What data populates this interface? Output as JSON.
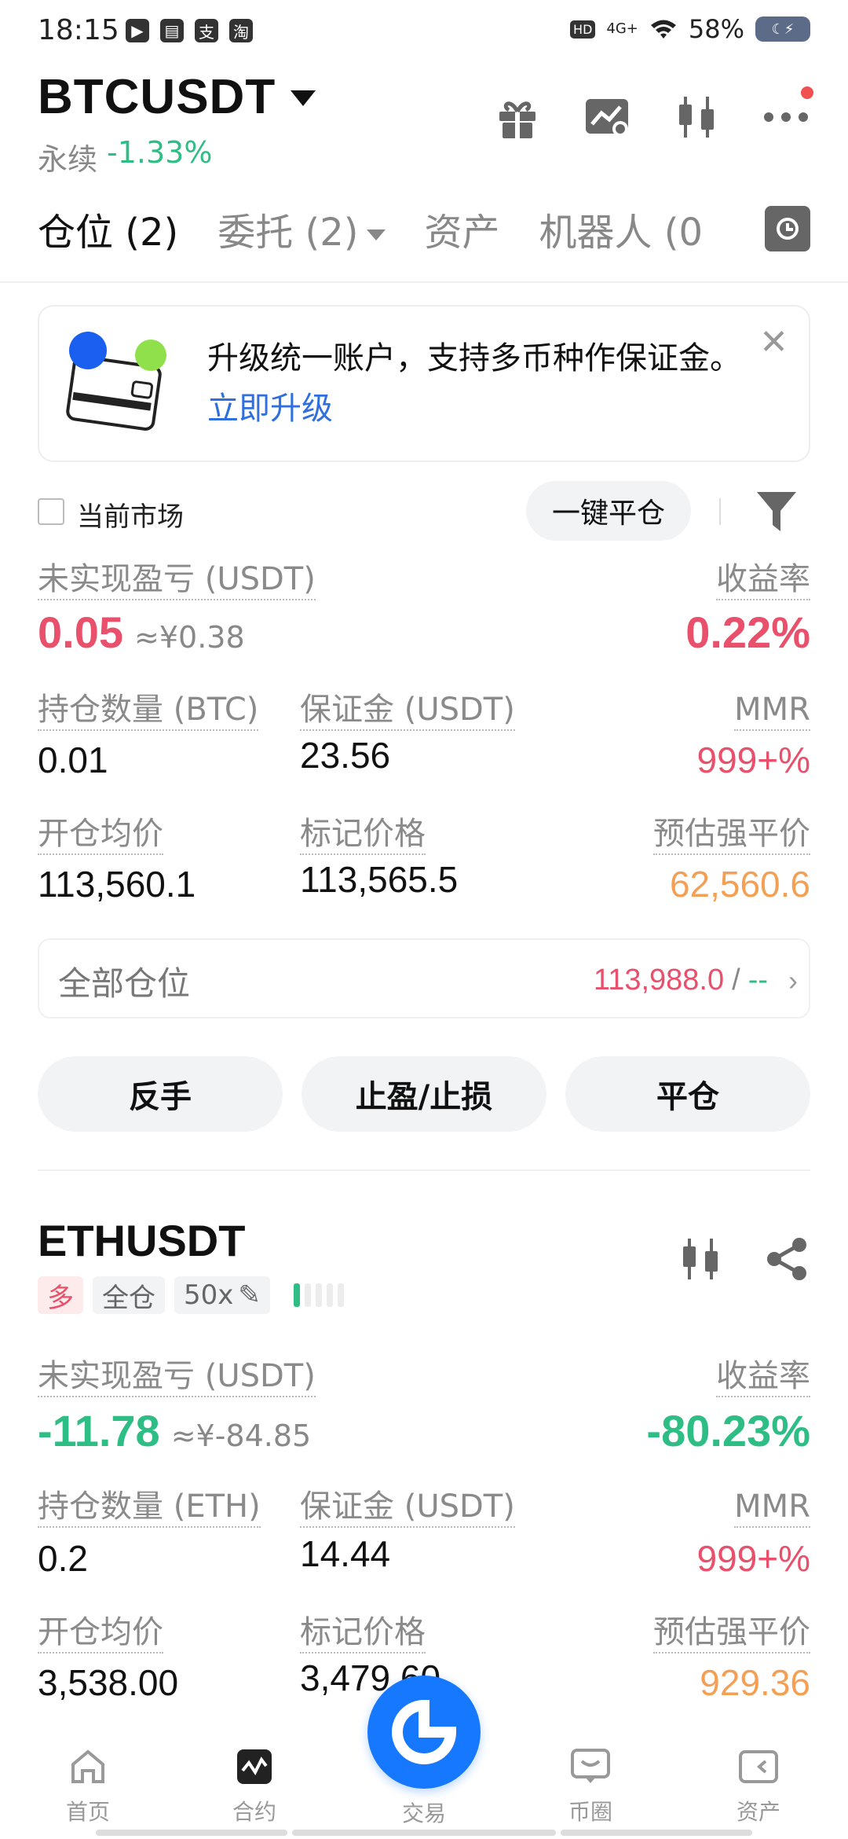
{
  "status_bar": {
    "time": "18:15",
    "icons": [
      "play-icon",
      "book-icon",
      "alipay-icon",
      "taobao-icon"
    ],
    "network": "4G+",
    "battery": "58%",
    "hd": "HD"
  },
  "header": {
    "pair": "BTCUSDT",
    "type": "永续",
    "change": "-1.33%"
  },
  "tabs": [
    {
      "label": "仓位 (2)",
      "active": true
    },
    {
      "label": "委托 (2)",
      "active": false
    },
    {
      "label": "资产",
      "active": false
    },
    {
      "label": "机器人 (0",
      "active": false
    }
  ],
  "banner": {
    "text": "升级统一账户，支持多币种作保证金。",
    "link": "立即升级"
  },
  "filter": {
    "current_market": "当前市场",
    "close_all": "一键平仓"
  },
  "btc_position": {
    "unrealized_label": "未实现盈亏 (USDT)",
    "unrealized": "0.05",
    "unrealized_cny": "≈¥0.38",
    "roe_label": "收益率",
    "roe": "0.22%",
    "size_label": "持仓数量 (BTC)",
    "size": "0.01",
    "margin_label": "保证金 (USDT)",
    "margin": "23.56",
    "mmr_label": "MMR",
    "mmr": "999+%",
    "entry_label": "开仓均价",
    "entry": "113,560.1",
    "mark_label": "标记价格",
    "mark": "113,565.5",
    "liq_label": "预估强平价",
    "liq": "62,560.6",
    "all_positions_label": "全部仓位",
    "all_positions_price": "113,988.0",
    "all_positions_sep": "/",
    "all_positions_other": "--",
    "buttons": {
      "reverse": "反手",
      "tp_sl": "止盈/止损",
      "close": "平仓"
    }
  },
  "eth_position": {
    "pair": "ETHUSDT",
    "side": "多",
    "margin_mode": "全仓",
    "leverage": "50x",
    "risk_level": 0.2,
    "unrealized_label": "未实现盈亏 (USDT)",
    "unrealized": "-11.78",
    "unrealized_cny": "≈¥-84.85",
    "roe_label": "收益率",
    "roe": "-80.23%",
    "size_label": "持仓数量 (ETH)",
    "size": "0.2",
    "margin_label": "保证金 (USDT)",
    "margin": "14.44",
    "mmr_label": "MMR",
    "mmr": "999+%",
    "entry_label": "开仓均价",
    "entry": "3,538.00",
    "mark_label": "标记价格",
    "mark": "3,479.60",
    "liq_label": "预估强平价",
    "liq": "929.36"
  },
  "bottom_nav": [
    {
      "label": "首页",
      "icon": "home-icon"
    },
    {
      "label": "合约",
      "icon": "futures-icon"
    },
    {
      "label": "交易",
      "icon": "trade-icon"
    },
    {
      "label": "币圈",
      "icon": "community-icon"
    },
    {
      "label": "资产",
      "icon": "wallet-icon"
    }
  ],
  "colors": {
    "green": "#2ebd85",
    "red": "#e8506b",
    "orange": "#f4a054",
    "blue": "#1677ff",
    "link": "#2f6fde"
  }
}
